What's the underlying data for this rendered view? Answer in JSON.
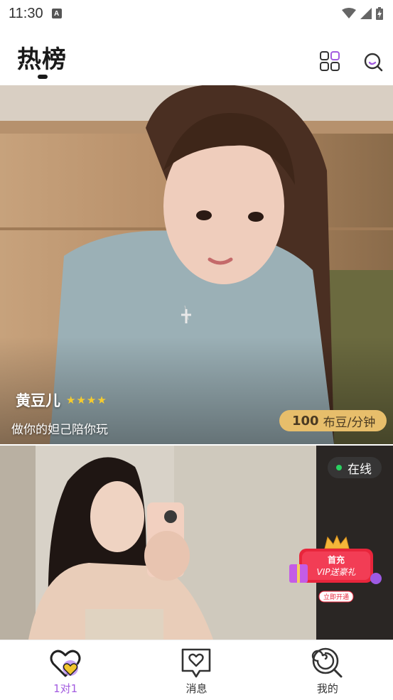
{
  "status_bar": {
    "time": "11:30",
    "notif_icon": "A"
  },
  "header": {
    "title": "热榜"
  },
  "hosts": [
    {
      "name": "黄豆儿",
      "stars": 4,
      "signature": "做你的妲己陪你玩",
      "price_value": "100",
      "price_unit": "布豆/分钟"
    },
    {
      "online_label": "在线"
    }
  ],
  "promo": {
    "line1": "首充",
    "line2": "VIP送豪礼",
    "cta": "立即开通"
  },
  "bottom_nav": [
    {
      "label": "1对1",
      "icon": "heart-icon",
      "active": true
    },
    {
      "label": "消息",
      "icon": "message-heart-icon",
      "active": false
    },
    {
      "label": "我的",
      "icon": "lollipop-icon",
      "active": false
    }
  ],
  "colors": {
    "accent": "#a35ce0",
    "gold": "#e7be6b",
    "online": "#29d160"
  }
}
